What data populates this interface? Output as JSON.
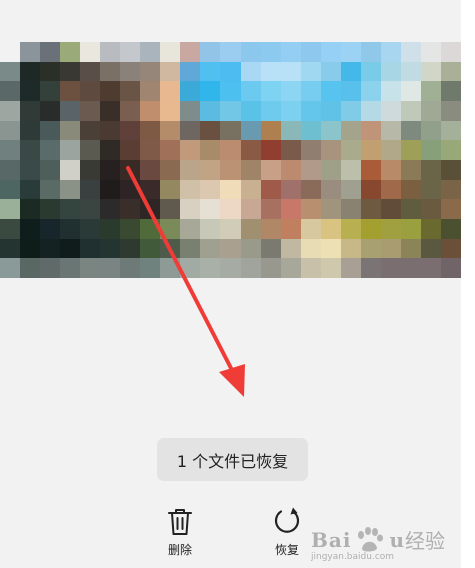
{
  "toast": {
    "text": "1 个文件已恢复"
  },
  "actions": {
    "delete": {
      "label": "删除",
      "icon": "trash-icon"
    },
    "restore": {
      "label": "恢复",
      "icon": "restore-icon"
    }
  },
  "watermark": {
    "brand_latin_a": "Bai",
    "brand_latin_b": "u",
    "brand_cn": "经验",
    "url": "jingyan.baidu.com"
  },
  "colors": {
    "background": "#f2f2f2",
    "toast_bg": "#e3e3e3",
    "annotation_arrow": "#f03c36",
    "text": "#222222"
  },
  "photo_tiles": [
    "#f2f2f2",
    "#8b939b",
    "#6a7178",
    "#9aaa78",
    "#eae8de",
    "#b8bcc0",
    "#c4c8cc",
    "#aab4bc",
    "#e8e6da",
    "#c8a8a0",
    "#92c4e8",
    "#9acdef",
    "#8cc8ee",
    "#8ccaf0",
    "#94cef2",
    "#8ec8ee",
    "#96d0f4",
    "#9cd2f4",
    "#90c8ea",
    "#a8d6f0",
    "#d0e0e8",
    "#e4e6e6",
    "#ddd8d8",
    "#7a8a88",
    "#1e2824",
    "#2a3028",
    "#3a3832",
    "#5a4e48",
    "#7a7066",
    "#8a827a",
    "#96867a",
    "#d0b8a0",
    "#5fa8d8",
    "#4fc0f0",
    "#4dbcf0",
    "#a8d8f4",
    "#b8e0f6",
    "#b8e0f6",
    "#a0d8f2",
    "#88cbea",
    "#44b8e8",
    "#78cce8",
    "#a8d6e4",
    "#c0dce2",
    "#d2d6c8",
    "#a8b098",
    "#5a6868",
    "#1e2a28",
    "#34403a",
    "#6c5040",
    "#5e4a3e",
    "#4e3c30",
    "#6a5446",
    "#a08670",
    "#e8b890",
    "#3caad8",
    "#30b6ea",
    "#4cc0ee",
    "#6ccaf0",
    "#7ed2f2",
    "#8cd6f4",
    "#76cdf0",
    "#56c4ee",
    "#58c0ea",
    "#8cd2ec",
    "#c8e2ea",
    "#e0e8e6",
    "#a0b094",
    "#707a6c",
    "#9ea6a2",
    "#303a36",
    "#2a2c2c",
    "#5a6468",
    "#6a5a50",
    "#3a2e28",
    "#7a5e50",
    "#c08e6c",
    "#e8b88e",
    "#7e8c8c",
    "#5cbbe0",
    "#72c6e6",
    "#5ac2e6",
    "#6ecbee",
    "#7cd0f0",
    "#64c6ea",
    "#60c2e6",
    "#80cbe6",
    "#b4dae6",
    "#cedadc",
    "#c0c8ba",
    "#a0a896",
    "#8a8c80",
    "#8a9490",
    "#2e3a38",
    "#4a5a5a",
    "#8a8a7a",
    "#4a4038",
    "#4a3a32",
    "#60403a",
    "#7e5a44",
    "#b48c6a",
    "#6e6660",
    "#6a5040",
    "#787060",
    "#6a9ab0",
    "#ae8050",
    "#8ab8b8",
    "#6ec0d0",
    "#8cc4cc",
    "#a4a48c",
    "#c09478",
    "#b8b8a8",
    "#7e8a7e",
    "#90a08a",
    "#a4b09a",
    "#70807e",
    "#3a4846",
    "#5a6c6a",
    "#9ca4a0",
    "#5a5a50",
    "#302a26",
    "#5a3e34",
    "#805a48",
    "#a07058",
    "#c09a7a",
    "#a88c6a",
    "#bc8c70",
    "#8a5a44",
    "#903e30",
    "#7a5a4a",
    "#907e70",
    "#a8947e",
    "#aaaa8c",
    "#c0a070",
    "#b0a888",
    "#9ea05a",
    "#88a07a",
    "#98a878",
    "#586866",
    "#3a4a48",
    "#4e5e5a",
    "#d0d0c8",
    "#3a3a34",
    "#262020",
    "#3a2a26",
    "#6a4a40",
    "#8a6a50",
    "#baa48a",
    "#c0a484",
    "#bc9274",
    "#a08468",
    "#c8a088",
    "#bc8a6e",
    "#b29a8a",
    "#9ea088",
    "#bcc0aa",
    "#aa5c38",
    "#b88a68",
    "#8a7a58",
    "#6a6448",
    "#5a5038",
    "#4e6662",
    "#2a3c3a",
    "#5a6a64",
    "#8a9288",
    "#3a4040",
    "#201c1c",
    "#2e2426",
    "#3a2a2a",
    "#948860",
    "#d0c0a8",
    "#dcc8b0",
    "#f0dcb8",
    "#c8b090",
    "#a05a4a",
    "#a0706a",
    "#8a6a58",
    "#9a8c7e",
    "#a0a090",
    "#884830",
    "#a06a4a",
    "#7a6040",
    "#6a6448",
    "#7a6448",
    "#9ab098",
    "#1c2a24",
    "#2a3a30",
    "#34443e",
    "#3a4440",
    "#2c2a2a",
    "#3a2e2a",
    "#2e2624",
    "#605a4e",
    "#d8d0c0",
    "#e6e0d4",
    "#ecd8c4",
    "#c8a894",
    "#a87060",
    "#c87868",
    "#b89070",
    "#a0947c",
    "#8a8270",
    "#6e5a40",
    "#604c38",
    "#605c40",
    "#6a5a40",
    "#8a6a4a",
    "#3a4a40",
    "#0e1e1c",
    "#16262a",
    "#203030",
    "#2a3a36",
    "#2a3a2c",
    "#3a4a30",
    "#506a3a",
    "#7a8a58",
    "#a8a898",
    "#c8c8b8",
    "#d0ccb8",
    "#a09070",
    "#b08868",
    "#c08060",
    "#d8c8a0",
    "#d8c480",
    "#b8b050",
    "#a4a030",
    "#a0a040",
    "#9aa040",
    "#6a6a30",
    "#4a5030",
    "#243430",
    "#0e1c1a",
    "#142222",
    "#101c1c",
    "#203030",
    "#243430",
    "#2e3a30",
    "#405a3a",
    "#4e5a4a",
    "#7a8070",
    "#a0a090",
    "#aaa090",
    "#9a9a8a",
    "#7a7a70",
    "#c0b8a0",
    "#e8dcb4",
    "#ece0b4",
    "#c8b888",
    "#a8a070",
    "#a89c70",
    "#8a8458",
    "#5a5840",
    "#6a5038",
    "#8a9a98",
    "#5a6864",
    "#606a68",
    "#6a7674",
    "#7a8480",
    "#7a8482",
    "#6e7a78",
    "#70827e",
    "#8e9a96",
    "#a2aaa4",
    "#a8b0a8",
    "#a6aca4",
    "#a0a49c",
    "#98988e",
    "#a8a89a",
    "#c8c0a8",
    "#d0c8ac",
    "#a8a094",
    "#7a7474",
    "#7a6e70",
    "#7a6e70",
    "#7a6e70",
    "#706468"
  ]
}
